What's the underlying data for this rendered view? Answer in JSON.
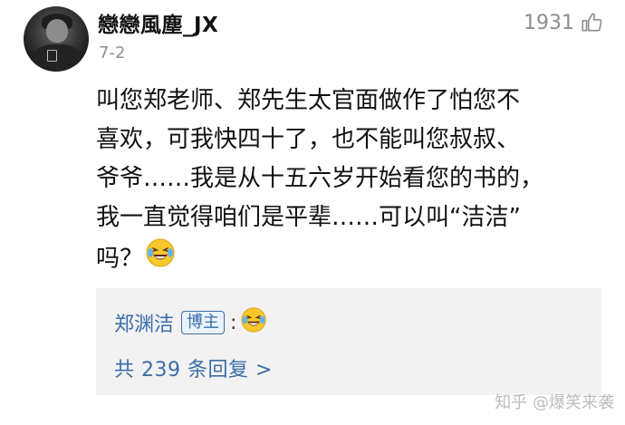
{
  "comment": {
    "username": "戀戀風塵_JX",
    "date": "7-2",
    "likes": "1931",
    "lines": [
      "叫您郑老师、郑先生太官面做作了怕您不",
      "喜欢，可我快四十了，也不能叫您叔叔、",
      "爷爷……我是从十五六岁开始看您的书的，",
      "我一直觉得咱们是平辈……可以叫“洁洁”",
      "吗？"
    ],
    "emoji_icon": "laugh-cry-emoji"
  },
  "reply": {
    "author": "郑渊洁",
    "badge": "博主",
    "colon": ":",
    "emoji_icon": "laugh-cry-emoji",
    "more_link": "共 239 条回复 >"
  },
  "watermark": {
    "text": "知乎 @爆笑来袭"
  },
  "colors": {
    "link_blue": "#3b6ea8",
    "muted_gray": "#8e8e8e",
    "reply_bg": "#f2f2f2"
  }
}
